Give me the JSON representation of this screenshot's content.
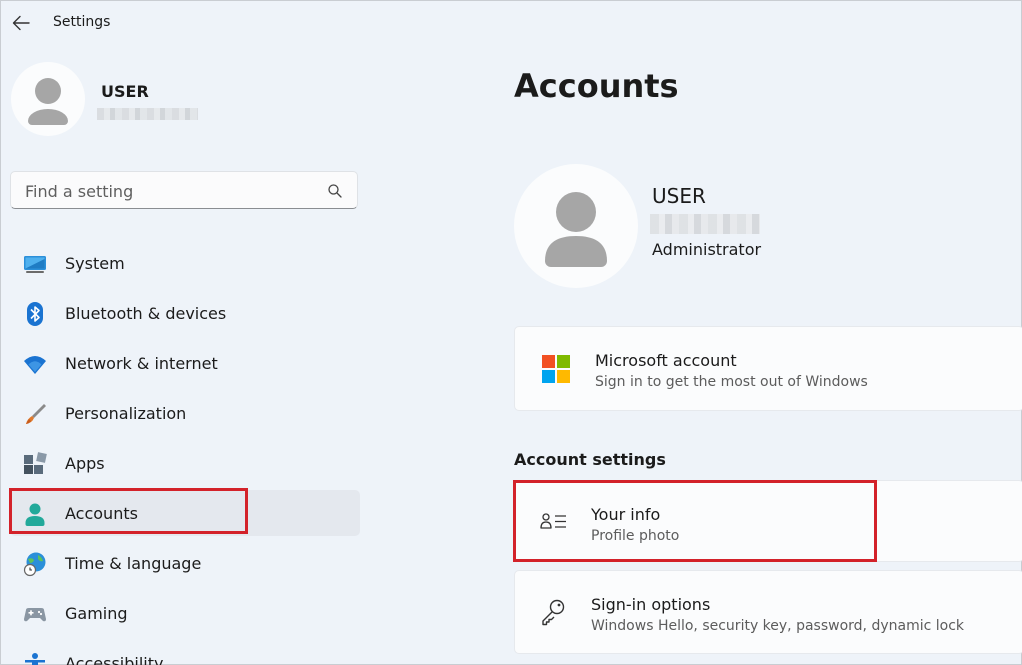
{
  "window": {
    "title": "Settings"
  },
  "sidebar": {
    "profile": {
      "name": "USER"
    },
    "search": {
      "placeholder": "Find a setting"
    },
    "items": [
      {
        "label": "System",
        "icon": "system-icon"
      },
      {
        "label": "Bluetooth & devices",
        "icon": "bluetooth-icon"
      },
      {
        "label": "Network & internet",
        "icon": "wifi-icon"
      },
      {
        "label": "Personalization",
        "icon": "brush-icon"
      },
      {
        "label": "Apps",
        "icon": "apps-icon"
      },
      {
        "label": "Accounts",
        "icon": "accounts-icon",
        "selected": true
      },
      {
        "label": "Time & language",
        "icon": "globe-clock-icon"
      },
      {
        "label": "Gaming",
        "icon": "gamepad-icon"
      },
      {
        "label": "Accessibility",
        "icon": "accessibility-icon"
      }
    ]
  },
  "main": {
    "title": "Accounts",
    "profile": {
      "name": "USER",
      "role": "Administrator"
    },
    "microsoft_account": {
      "title": "Microsoft account",
      "subtitle": "Sign in to get the most out of Windows"
    },
    "section_title": "Account settings",
    "your_info": {
      "title": "Your info",
      "subtitle": "Profile photo"
    },
    "sign_in": {
      "title": "Sign-in options",
      "subtitle": "Windows Hello, security key, password, dynamic lock"
    }
  },
  "colors": {
    "background": "#eef3f9",
    "card": "#fbfcfd",
    "highlight_red": "#d3222a",
    "accent": "#0078d4"
  }
}
